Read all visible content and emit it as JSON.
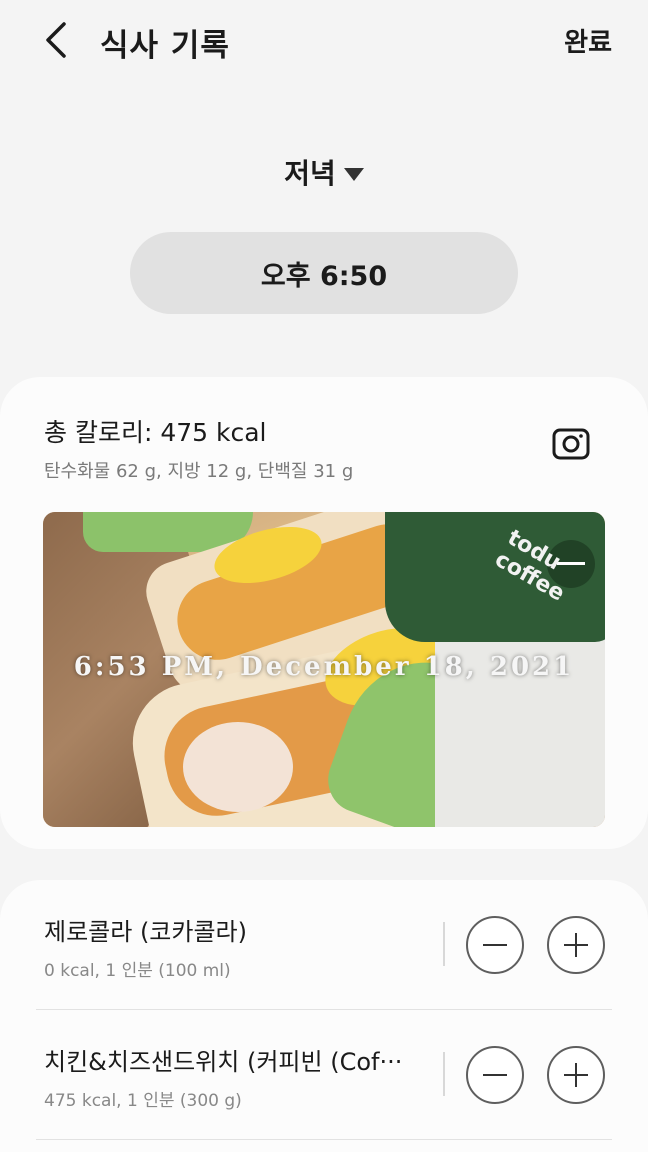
{
  "header": {
    "title": "식사 기록",
    "done_label": "완료"
  },
  "meal": {
    "type_label": "저녁",
    "time_label": "오후 6:50"
  },
  "summary": {
    "total_calories": "총 칼로리: 475 kcal",
    "macros": "탄수화물 62 g, 지방 12 g, 단백질 31 g",
    "photo_timestamp": "6:53 PM, December 18, 2021",
    "photo_cup_text": "todu coffee"
  },
  "foods": [
    {
      "name": "제로콜라 (코카콜라)",
      "detail": "0 kcal, 1 인분 (100 ml)"
    },
    {
      "name": "치킨&치즈샌드위치 (커피빈 (Cof···",
      "detail": "475 kcal, 1 인분 (300 g)"
    }
  ],
  "icons": {
    "back": "chevron-left-icon",
    "meal_dropdown": "caret-down-icon",
    "camera": "camera-icon",
    "minus": "minus-icon",
    "plus": "plus-icon"
  }
}
